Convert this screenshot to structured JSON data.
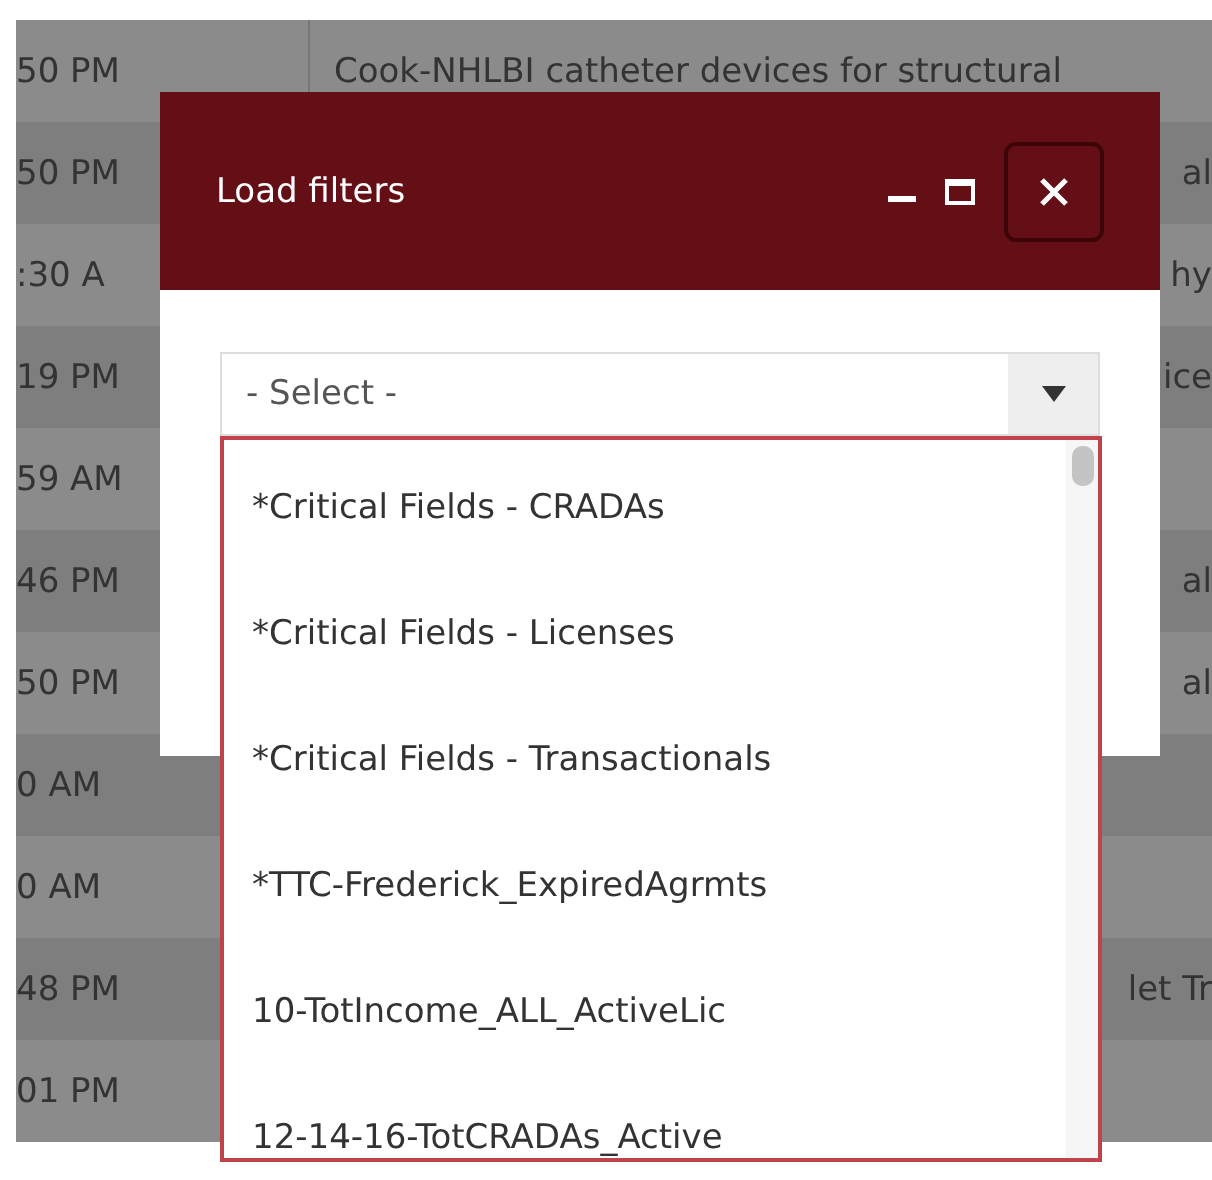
{
  "table": {
    "rows": [
      {
        "time": "50 PM",
        "title": "Cook-NHLBI catheter devices for structural"
      },
      {
        "time": "50 PM",
        "title": "al"
      },
      {
        "time": ":30 A",
        "title": "hy"
      },
      {
        "time": "19 PM",
        "title": "ice"
      },
      {
        "time": "59 AM"
      },
      {
        "time": "46 PM",
        "title": "al"
      },
      {
        "time": "50 PM",
        "title": "al"
      },
      {
        "time": "0 AM"
      },
      {
        "time": "0 AM"
      },
      {
        "time": "48 PM",
        "title": "let Tr"
      },
      {
        "time": "01 PM"
      }
    ]
  },
  "dialog": {
    "title": "Load filters",
    "select": {
      "placeholder": "- Select -",
      "expanded": true,
      "options": [
        {
          "label": "*Critical Fields - CRADAs"
        },
        {
          "label": "*Critical Fields - Licenses"
        },
        {
          "label": "*Critical Fields - Transactionals"
        },
        {
          "label": "*TTC-Frederick_ExpiredAgrmts"
        },
        {
          "label": "10-TotIncome_ALL_ActiveLic"
        },
        {
          "label": "12-14-16-TotCRADAs_Active"
        }
      ]
    }
  }
}
